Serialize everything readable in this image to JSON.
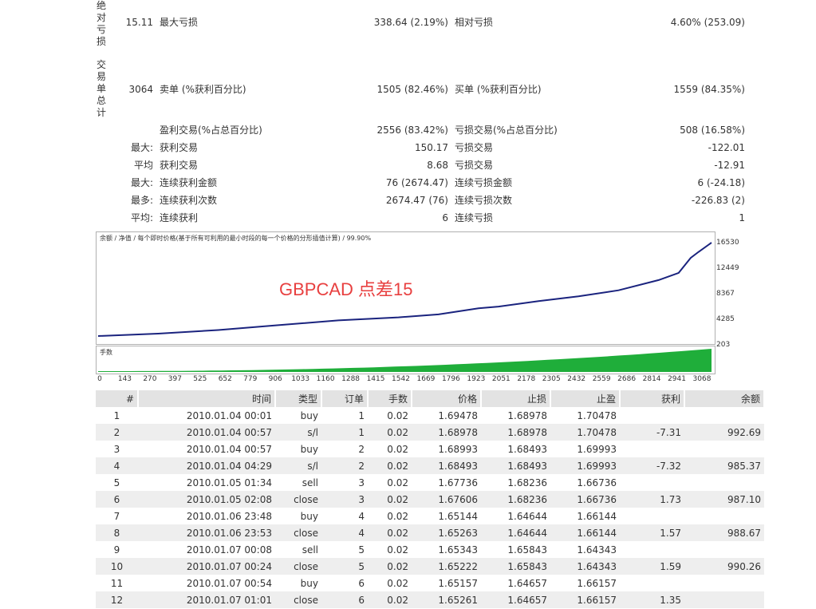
{
  "vertical_labels": {
    "abs_drawdown": "绝对亏损",
    "total_trades": "交易单总计"
  },
  "stats": {
    "abs_dd_value": "15.11",
    "max_dd_label": "最大亏损",
    "max_dd_value": "338.64 (2.19%)",
    "rel_dd_label": "相对亏损",
    "rel_dd_value": "4.60% (253.09)",
    "total_trades_value": "3064",
    "short_label": "卖单 (%获利百分比)",
    "short_value": "1505 (82.46%)",
    "long_label": "买单 (%获利百分比)",
    "long_value": "1559 (84.35%)",
    "profit_trades_label": "盈利交易(%占总百分比)",
    "profit_trades_value": "2556 (83.42%)",
    "loss_trades_label": "亏损交易(%占总百分比)",
    "loss_trades_value": "508 (16.58%)",
    "largest_prefix": "最大:",
    "largest_profit_label": "获利交易",
    "largest_profit_value": "150.17",
    "largest_loss_label": "亏损交易",
    "largest_loss_value": "-122.01",
    "average_prefix": "平均",
    "average_profit_label": "获利交易",
    "average_profit_value": "8.68",
    "average_loss_label": "亏损交易",
    "average_loss_value": "-12.91",
    "max_consec_prefix": "最大:",
    "max_consec_wins_label": "连续获利金额",
    "max_consec_wins_value": "76 (2674.47)",
    "max_consec_losses_label": "连续亏损金额",
    "max_consec_losses_value": "6 (-24.18)",
    "maximal_prefix": "最多:",
    "maximal_wins_label": "连续获利次数",
    "maximal_wins_value": "2674.47 (76)",
    "maximal_losses_label": "连续亏损次数",
    "maximal_losses_value": "-226.83 (2)",
    "avg_consec_prefix": "平均:",
    "avg_consec_wins_label": "连续获利",
    "avg_consec_wins_value": "6",
    "avg_consec_losses_label": "连续亏损",
    "avg_consec_losses_value": "1"
  },
  "graph": {
    "caption": "余额 / 净值 / 每个即时价格(基于所有可利用的最小时段的每一个价格的分形插值计算) / 99.90%",
    "lots_caption": "手数",
    "watermark": "GBPCAD 点差15",
    "line_color": "#1a237e",
    "lots_color": "#1fae3a",
    "y_ticks": [
      "16530",
      "12449",
      "8367",
      "4285",
      "203"
    ],
    "x_ticks": [
      "0",
      "143",
      "270",
      "397",
      "525",
      "652",
      "779",
      "906",
      "1033",
      "1160",
      "1288",
      "1415",
      "1542",
      "1669",
      "1796",
      "1923",
      "2051",
      "2178",
      "2305",
      "2432",
      "2559",
      "2686",
      "2814",
      "2941",
      "3068"
    ],
    "balance_series": [
      [
        0,
        1000
      ],
      [
        300,
        1400
      ],
      [
        600,
        2000
      ],
      [
        900,
        2800
      ],
      [
        1200,
        3600
      ],
      [
        1500,
        4100
      ],
      [
        1700,
        4600
      ],
      [
        1900,
        5600
      ],
      [
        2000,
        5900
      ],
      [
        2200,
        6800
      ],
      [
        2400,
        7600
      ],
      [
        2600,
        8600
      ],
      [
        2800,
        10300
      ],
      [
        2900,
        11500
      ],
      [
        2960,
        14000
      ],
      [
        3000,
        15000
      ],
      [
        3064,
        16530
      ]
    ]
  },
  "orders": {
    "headers": [
      "#",
      "时间",
      "类型",
      "订单",
      "手数",
      "价格",
      "止损",
      "止盈",
      "获利",
      "余额"
    ],
    "rows": [
      [
        "1",
        "2010.01.04 00:01",
        "buy",
        "1",
        "0.02",
        "1.69478",
        "1.68978",
        "1.70478",
        "",
        ""
      ],
      [
        "2",
        "2010.01.04 00:57",
        "s/l",
        "1",
        "0.02",
        "1.68978",
        "1.68978",
        "1.70478",
        "-7.31",
        "992.69"
      ],
      [
        "3",
        "2010.01.04 00:57",
        "buy",
        "2",
        "0.02",
        "1.68993",
        "1.68493",
        "1.69993",
        "",
        ""
      ],
      [
        "4",
        "2010.01.04 04:29",
        "s/l",
        "2",
        "0.02",
        "1.68493",
        "1.68493",
        "1.69993",
        "-7.32",
        "985.37"
      ],
      [
        "5",
        "2010.01.05 01:34",
        "sell",
        "3",
        "0.02",
        "1.67736",
        "1.68236",
        "1.66736",
        "",
        ""
      ],
      [
        "6",
        "2010.01.05 02:08",
        "close",
        "3",
        "0.02",
        "1.67606",
        "1.68236",
        "1.66736",
        "1.73",
        "987.10"
      ],
      [
        "7",
        "2010.01.06 23:48",
        "buy",
        "4",
        "0.02",
        "1.65144",
        "1.64644",
        "1.66144",
        "",
        ""
      ],
      [
        "8",
        "2010.01.06 23:53",
        "close",
        "4",
        "0.02",
        "1.65263",
        "1.64644",
        "1.66144",
        "1.57",
        "988.67"
      ],
      [
        "9",
        "2010.01.07 00:08",
        "sell",
        "5",
        "0.02",
        "1.65343",
        "1.65843",
        "1.64343",
        "",
        ""
      ],
      [
        "10",
        "2010.01.07 00:24",
        "close",
        "5",
        "0.02",
        "1.65222",
        "1.65843",
        "1.64343",
        "1.59",
        "990.26"
      ],
      [
        "11",
        "2010.01.07 00:54",
        "buy",
        "6",
        "0.02",
        "1.65157",
        "1.64657",
        "1.66157",
        "",
        ""
      ],
      [
        "12",
        "2010.01.07 01:01",
        "close",
        "6",
        "0.02",
        "1.65261",
        "1.64657",
        "1.66157",
        "1.35",
        ""
      ]
    ]
  }
}
